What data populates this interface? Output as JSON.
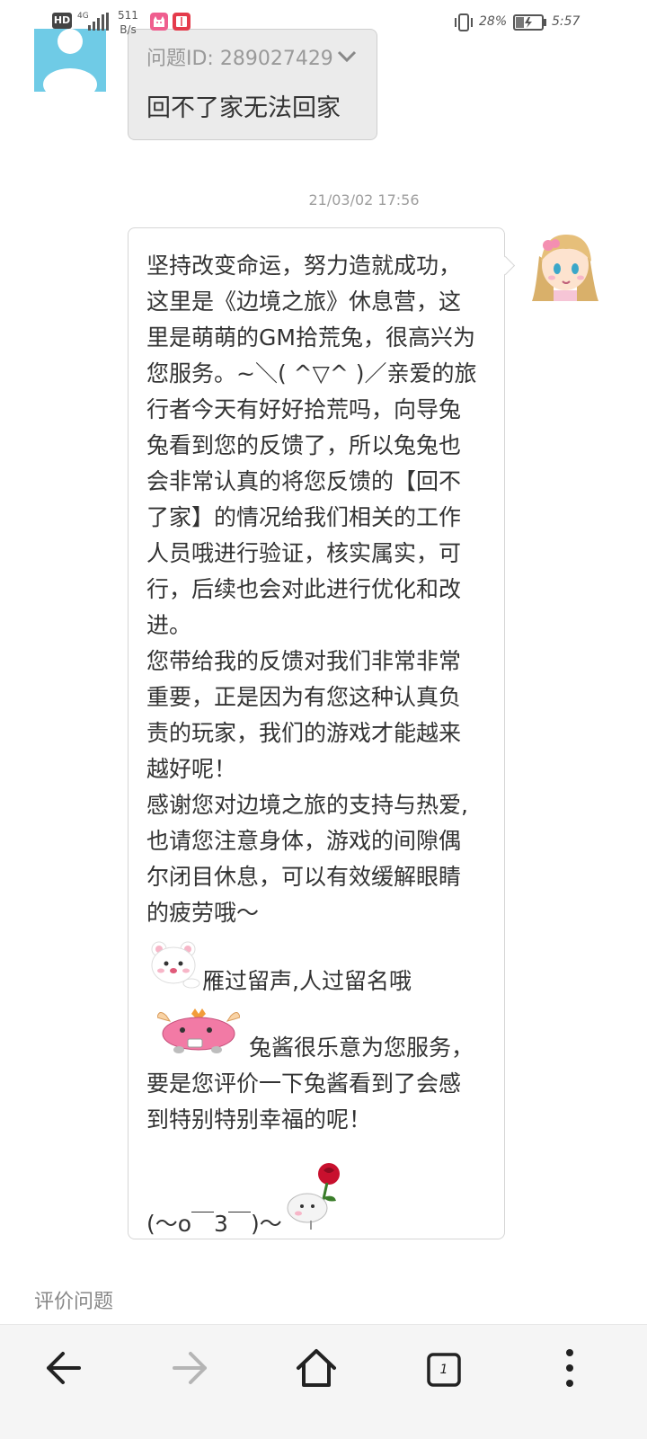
{
  "status_bar": {
    "hd_label": "HD",
    "network": "4G",
    "speed_value": "511",
    "speed_unit": "B/s",
    "battery_pct": "28%",
    "time": "5:57",
    "icons": [
      "hd-icon",
      "signal-icon",
      "app-cat-icon",
      "app-book-icon",
      "vibrate-icon",
      "battery-icon"
    ]
  },
  "question": {
    "id_label": "问题ID: 289027429",
    "text": "回不了家无法回家"
  },
  "timestamp": "21/03/02 17:56",
  "answer": {
    "paragraph1": "坚持改变命运，努力造就成功，这里是《边境之旅》休息营，这里是萌萌的GM拾荒兔，很高兴为您服务。~＼( ^▽^ )／亲爱的旅行者今天有好好拾荒吗，向导兔兔看到您的反馈了，所以兔兔也会非常认真的将您反馈的【回不了家】的情况给我们相关的工作人员哦进行验证，核实属实，可行，后续也会对此进行优化和改进。",
    "paragraph2": "您带给我的反馈对我们非常非常重要，正是因为有您这种认真负责的玩家，我们的游戏才能越来越好呢！",
    "paragraph3": "感谢您对边境之旅的支持与热爱,也请您注意身体，游戏的间隙偶尔闭目休息，可以有效缓解眼睛的疲劳哦～",
    "sticker_line1": "雁过留声,人过留名哦",
    "sticker_line2": "兔酱很乐意为您服务，要是您评价一下兔酱看到了会感到特别特别幸福的呢！",
    "closing": "(～o￣3￣)～"
  },
  "rate_label": "评价问题",
  "nav": {
    "tab_count": "1",
    "items": [
      "back-icon",
      "forward-icon",
      "home-icon",
      "tabs-icon",
      "more-icon"
    ]
  },
  "colors": {
    "user_avatar": "#6fcbe6",
    "question_bubble": "#ebebeb",
    "navbar": "#f5f5f5"
  }
}
